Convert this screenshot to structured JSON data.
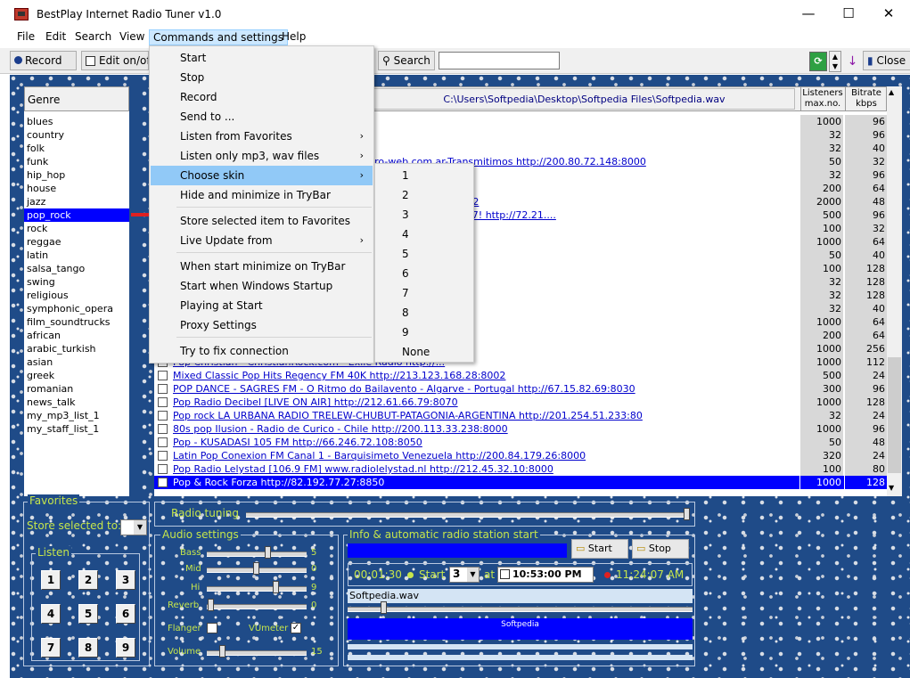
{
  "window": {
    "title": "BestPlay Internet Radio Tuner v1.0",
    "minimize": "—",
    "maximize": "☐",
    "close": "✕"
  },
  "menubar": [
    "File",
    "Edit",
    "Search",
    "View",
    "Commands and settings",
    "Help"
  ],
  "toolbar": {
    "record": "Record",
    "edit_onoff": "Edit on/off",
    "search": "Search",
    "search_value": "",
    "close": "Close"
  },
  "genre_header": "Genre",
  "genres": [
    "blues",
    "country",
    "folk",
    "funk",
    "hip_hop",
    "house",
    "jazz",
    "pop_rock",
    "rock",
    "reggae",
    "latin",
    "salsa_tango",
    "swing",
    "religious",
    "symphonic_opera",
    "film_soundtrucks",
    "african",
    "arabic_turkish",
    "asian",
    "greek",
    "romanian",
    "news_talk",
    "my_mp3_list_1",
    "my_staff_list_1"
  ],
  "selected_genre": "pop_rock",
  "grid": {
    "path": "C:\\Users\\Softpedia\\Desktop\\Softpedia Files\\Softpedia.wav",
    "col_listeners": "Listeners max.no.",
    "col_bitrate": "Bitrate kbps",
    "rows": [
      {
        "name": "…990",
        "listeners": "1000",
        "bitrate": "96"
      },
      {
        "name": "…o - Chile' http://200.54.182.4:8004",
        "listeners": "32",
        "bitrate": "96"
      },
      {
        "name": "…ntina http://200.59.49.83:8002",
        "listeners": "32",
        "bitrate": "40"
      },
      {
        "name": "…os Aires-Argentina-Powered by www.euro-web.com.ar-Transmitimos http://200.80.72.148:8000",
        "listeners": "50",
        "bitrate": "32"
      },
      {
        "name": "…9000",
        "listeners": "32",
        "bitrate": "96"
      },
      {
        "name": "",
        "listeners": "200",
        "bitrate": "64"
      },
      {
        "name": "…c channel ]] www.radiomax.fm ] http://195.228.156.38:8182",
        "listeners": "2000",
        "bitrate": "48"
      },
      {
        "name": "…t Contemporary And Classic Hits Live From Nottingham 24/7! http://72.21....",
        "listeners": "500",
        "bitrate": "96"
      },
      {
        "name": "",
        "listeners": "100",
        "bitrate": "32"
      },
      {
        "name": "",
        "listeners": "1000",
        "bitrate": "64"
      },
      {
        "name": "…74.5:6220",
        "listeners": "50",
        "bitrate": "40"
      },
      {
        "name": "",
        "listeners": "100",
        "bitrate": "128"
      },
      {
        "name": "… http://64.222.233.99:8000",
        "listeners": "32",
        "bitrate": "128"
      },
      {
        "name": "…9.14:8000",
        "listeners": "32",
        "bitrate": "128"
      },
      {
        "name": "",
        "listeners": "32",
        "bitrate": "40"
      },
      {
        "name": "…192.77.18:8750",
        "listeners": "1000",
        "bitrate": "64"
      },
      {
        "name": "",
        "listeners": "200",
        "bitrate": "64"
      },
      {
        "name": "…ct http://81.18.12.185:2214",
        "listeners": "1000",
        "bitrate": "256"
      },
      {
        "name": "Pop Christian - ChristianRock.com - Exile Radio http://...",
        "listeners": "1000",
        "bitrate": "112"
      },
      {
        "name": "Mixed Classic Pop Hits Regency FM 40K http://213.123.168.28:8002",
        "listeners": "500",
        "bitrate": "24"
      },
      {
        "name": "POP DANCE - SAGRES FM - O Ritmo do Bailavento - Algarve - Portugal http://67.15.82.69:8030",
        "listeners": "300",
        "bitrate": "96"
      },
      {
        "name": "Pop Radio Decibel [LIVE ON AIR] http://212.61.66.79:8070",
        "listeners": "1000",
        "bitrate": "128"
      },
      {
        "name": "Pop rock LA URBANA RADIO TRELEW-CHUBUT-PATAGONIA-ARGENTINA http://201.254.51.233:80",
        "listeners": "32",
        "bitrate": "24"
      },
      {
        "name": "80s pop Ilusion - Radio de Curico - Chile http://200.113.33.238:8000",
        "listeners": "1000",
        "bitrate": "96"
      },
      {
        "name": "Pop - KUSADASI 105 FM http://66.246.72.108:8050",
        "listeners": "50",
        "bitrate": "48"
      },
      {
        "name": "Latin Pop Conexion FM Canal 1 - Barquisimeto Venezuela http://200.84.179.26:8000",
        "listeners": "320",
        "bitrate": "24"
      },
      {
        "name": "Pop Radio Lelystad [106.9 FM] www.radiolelystad.nl http://212.45.32.10:8000",
        "listeners": "100",
        "bitrate": "80"
      },
      {
        "name": "Pop & Rock Forza http://82.192.77.27:8850",
        "listeners": "1000",
        "bitrate": "128",
        "selected": true
      }
    ]
  },
  "commands_menu": {
    "items": [
      {
        "label": "Start"
      },
      {
        "label": "Stop"
      },
      {
        "label": "Record"
      },
      {
        "label": "Send to ..."
      },
      {
        "label": "Listen from Favorites",
        "submenu": true
      },
      {
        "label": "Listen only mp3, wav files",
        "submenu": true
      },
      {
        "label": "Choose skin",
        "submenu": true,
        "highlight": true
      },
      {
        "label": "Hide and minimize in TryBar"
      },
      {
        "label": "Store selected item to Favorites"
      },
      {
        "label": "Live Update from",
        "submenu": true
      },
      {
        "label": "When start minimize on TryBar"
      },
      {
        "label": "Start when Windows Startup"
      },
      {
        "label": "Playing at Start"
      },
      {
        "label": "Proxy Settings"
      },
      {
        "label": "Try to fix connection"
      }
    ],
    "arrow": "›"
  },
  "skin_submenu": [
    "1",
    "2",
    "3",
    "4",
    "5",
    "6",
    "7",
    "8",
    "9",
    "None"
  ],
  "favorites": {
    "title": "Favorites",
    "store_label": "Store selected to:",
    "listen_title": "Listen",
    "buttons": [
      "1",
      "2",
      "3",
      "4",
      "5",
      "6",
      "7",
      "8",
      "9"
    ]
  },
  "tuning": {
    "label": "Radio tuning"
  },
  "audio": {
    "title": "Audio settings",
    "bass_label": "Bass",
    "bass_value": "5",
    "mid_label": "Mid",
    "mid_value": "0",
    "hi_label": "Hi",
    "hi_value": "9",
    "reverb_label": "Reverb",
    "reverb_value": "0",
    "flanger_label": "Flanger",
    "vumeter_label": "VUmeter",
    "volume_label": "Volume",
    "volume_value": "15",
    "vumeter_checked": "✓"
  },
  "info": {
    "title": "Info & automatic radio station start",
    "start_btn": "Start",
    "stop_btn": "Stop",
    "elapsed": "00:01:30",
    "start_label": "Start",
    "start_count": "3",
    "at_label": "at",
    "time_value": "10:53:00 PM",
    "clock": "11:24:07 AM",
    "file": "Softpedia.wav",
    "display": "Softpedia"
  }
}
